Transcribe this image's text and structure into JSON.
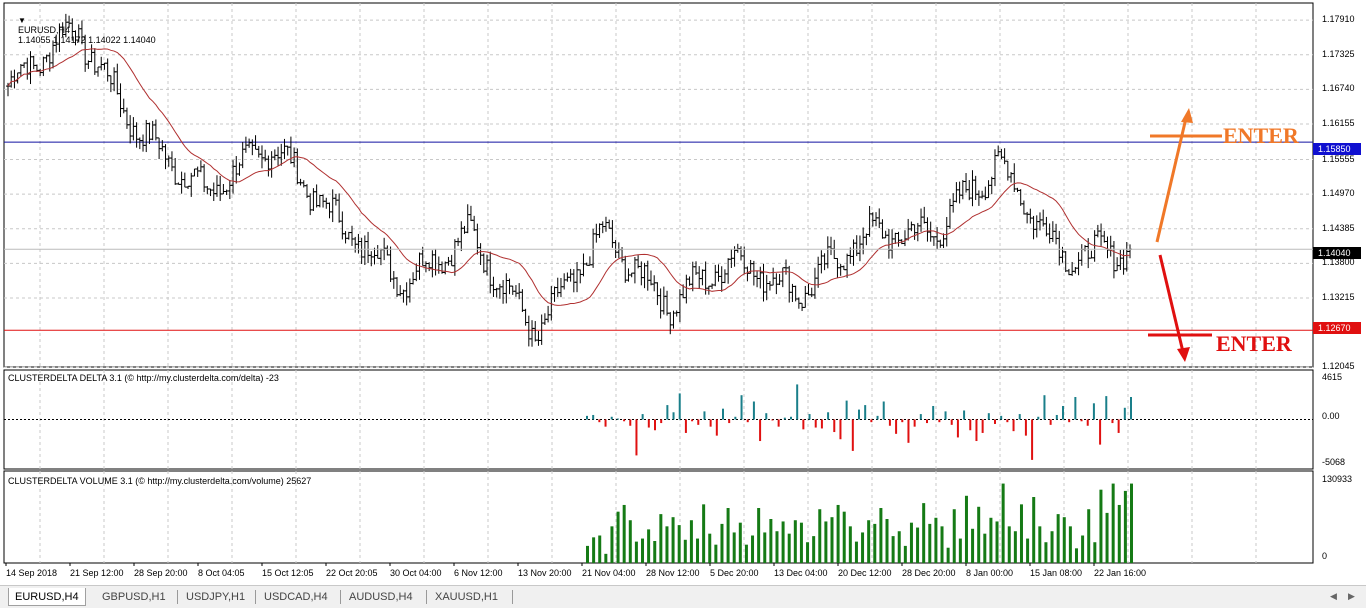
{
  "header": {
    "symbol_tf": "EURUSD,H4",
    "ohlc": "1.14055 1.14172 1.14022 1.14040"
  },
  "main_y_labels": [
    "1.17910",
    "1.17325",
    "1.16740",
    "1.16155",
    "1.15555",
    "1.14970",
    "1.14385",
    "1.13800",
    "1.13215",
    "1.12045"
  ],
  "price_boxes": {
    "upper_line": "1.15850",
    "current": "1.14040",
    "lower_line": "1.12670"
  },
  "x_labels": [
    "14 Sep 2018",
    "21 Sep 12:00",
    "28 Sep 20:00",
    "8 Oct 04:05",
    "15 Oct 12:05",
    "22 Oct 20:05",
    "30 Oct 04:00",
    "6 Nov 12:00",
    "13 Nov 20:00",
    "21 Nov 04:00",
    "28 Nov 12:00",
    "5 Dec 20:00",
    "13 Dec 04:00",
    "20 Dec 12:00",
    "28 Dec 20:00",
    "8 Jan 00:00",
    "15 Jan 08:00",
    "22 Jan 16:00"
  ],
  "delta_panel": {
    "label": "CLUSTERDELTA DELTA 3.1 (© http://my.clusterdelta.com/delta) -23",
    "top": "4615",
    "mid": "0.00",
    "bottom": "-5068"
  },
  "volume_panel": {
    "label": "CLUSTERDELTA VOLUME 3.1 (© http://my.clusterdelta.com/volume) 25627",
    "top": "130933",
    "bottom": "0"
  },
  "annotations": {
    "enter_up": "ENTER",
    "enter_down": "ENTER"
  },
  "tabs": [
    "EURUSD,H4",
    "GBPUSD,H1",
    "USDJPY,H1",
    "USDCAD,H4",
    "AUDUSD,H4",
    "XAUUSD,H1"
  ],
  "colors": {
    "bull_delta": "#1a7f8a",
    "bear_delta": "#e01010",
    "volume": "#157a15",
    "ma": "#b03030",
    "enter_up": "#f07828",
    "enter_down": "#e01010"
  },
  "chart_data": [
    {
      "type": "ohlc",
      "symbol": "EURUSD",
      "timeframe": "H4",
      "ylim": [
        1.1205,
        1.182
      ],
      "grid": true,
      "horizontal_lines": [
        1.1585,
        1.1267
      ],
      "close_path": [
        {
          "x": "14 Sep 2018",
          "y": 1.168
        },
        {
          "x": "21 Sep 12:00",
          "y": 1.178
        },
        {
          "x": "28 Sep 20:00",
          "y": 1.16
        },
        {
          "x": "8 Oct 04:05",
          "y": 1.15
        },
        {
          "x": "15 Oct 12:05",
          "y": 1.158
        },
        {
          "x": "22 Oct 20:05",
          "y": 1.145
        },
        {
          "x": "30 Oct 04:00",
          "y": 1.135
        },
        {
          "x": "6 Nov 12:00",
          "y": 1.143
        },
        {
          "x": "13 Nov 20:00",
          "y": 1.126
        },
        {
          "x": "21 Nov 04:00",
          "y": 1.143
        },
        {
          "x": "28 Nov 12:00",
          "y": 1.131
        },
        {
          "x": "5 Dec 20:00",
          "y": 1.139
        },
        {
          "x": "13 Dec 04:00",
          "y": 1.133
        },
        {
          "x": "20 Dec 12:00",
          "y": 1.143
        },
        {
          "x": "28 Dec 20:00",
          "y": 1.143
        },
        {
          "x": "8 Jan 00:00",
          "y": 1.155
        },
        {
          "x": "15 Jan 08:00",
          "y": 1.139
        },
        {
          "x": "22 Jan 16:00",
          "y": 1.1404
        }
      ]
    },
    {
      "type": "bar",
      "name": "CLUSTERDELTA DELTA",
      "ylim": [
        -5068,
        4615
      ],
      "values": [
        400,
        500,
        -300,
        -800,
        300,
        100,
        -200,
        -700,
        -4000,
        600,
        -900,
        -1200,
        -400,
        1600,
        800,
        2900,
        -1500,
        -200,
        -600,
        900,
        -800,
        -1800,
        1200,
        -400,
        300,
        2700,
        -300,
        2000,
        -2400,
        700,
        -100,
        -800,
        200,
        300,
        3900,
        -1100,
        600,
        -900,
        -1000,
        800,
        -1400,
        -2200,
        2100,
        -3500,
        1100,
        1600,
        -300,
        400,
        2000,
        -700,
        -1600,
        -300,
        -2600,
        -800,
        600,
        -400,
        1500,
        -300,
        900,
        -600,
        -2000,
        1000,
        -1200,
        -2400,
        -1500,
        700,
        -500,
        400,
        -300,
        -1300,
        600,
        -1800,
        -4500,
        300,
        2700,
        -600,
        500,
        1500,
        -300,
        2500,
        -200,
        -700,
        1800,
        -2800,
        2600,
        -400,
        -1500,
        1300,
        2500
      ]
    },
    {
      "type": "bar",
      "name": "CLUSTERDELTA VOLUME",
      "ylim": [
        0,
        130933
      ],
      "values": [
        28000,
        42000,
        45000,
        15000,
        60000,
        84000,
        95000,
        70000,
        35000,
        40000,
        55000,
        36000,
        80000,
        60000,
        75000,
        62000,
        38000,
        70000,
        40000,
        96000,
        48000,
        30000,
        64000,
        90000,
        50000,
        66000,
        30000,
        45000,
        90000,
        50000,
        72000,
        52000,
        68000,
        48000,
        70000,
        66000,
        34000,
        44000,
        88000,
        68000,
        75000,
        95000,
        84000,
        60000,
        35000,
        50000,
        70000,
        64000,
        90000,
        72000,
        44000,
        52000,
        28000,
        66000,
        58000,
        98000,
        64000,
        74000,
        60000,
        25000,
        88000,
        40000,
        110000,
        56000,
        92000,
        48000,
        74000,
        68000,
        130000,
        60000,
        52000,
        96000,
        40000,
        108000,
        60000,
        34000,
        52000,
        80000,
        75000,
        60000,
        24000,
        45000,
        88000,
        34000,
        120000,
        82000,
        130000,
        95000,
        118000,
        130000
      ]
    }
  ]
}
